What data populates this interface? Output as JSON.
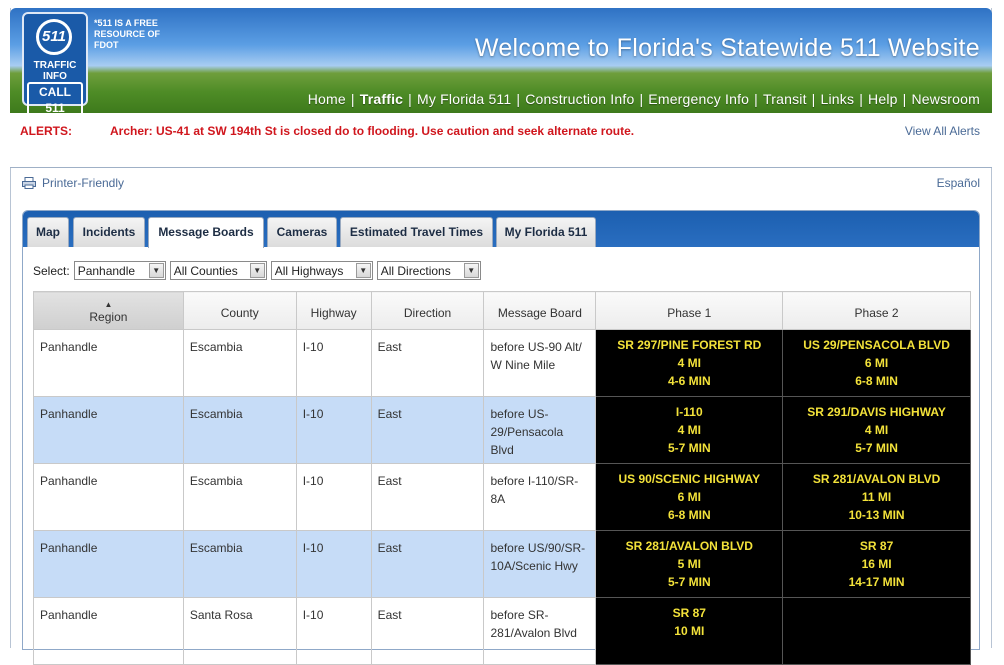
{
  "header": {
    "logo": {
      "number": "511",
      "line1": "TRAFFIC",
      "line2": "INFO",
      "call": "CALL 511"
    },
    "tagline": "*511 IS A FREE RESOURCE OF FDOT",
    "title": "Welcome to Florida's Statewide 511 Website",
    "nav": [
      "Home",
      "Traffic",
      "My Florida 511",
      "Construction Info",
      "Emergency Info",
      "Transit",
      "Links",
      "Help",
      "Newsroom"
    ],
    "active_nav": "Traffic"
  },
  "alerts": {
    "label": "ALERTS:",
    "text": "Archer: US-41 at SW 194th St is closed do to flooding. Use caution and seek alternate route.",
    "view_all": "View All Alerts"
  },
  "utility": {
    "printer": "Printer-Friendly",
    "language": "Español"
  },
  "tabs": [
    {
      "label": "Map"
    },
    {
      "label": "Incidents"
    },
    {
      "label": "Message Boards"
    },
    {
      "label": "Cameras"
    },
    {
      "label": "Estimated Travel Times"
    },
    {
      "label": "My Florida 511"
    }
  ],
  "active_tab": "Message Boards",
  "filters": {
    "label": "Select:",
    "region": "Panhandle",
    "county": "All Counties",
    "highway": "All Highways",
    "direction": "All Directions"
  },
  "table": {
    "headers": [
      "Region",
      "County",
      "Highway",
      "Direction",
      "Message Board",
      "Phase 1",
      "Phase 2"
    ],
    "rows": [
      {
        "region": "Panhandle",
        "county": "Escambia",
        "highway": "I-10",
        "direction": "East",
        "board": "before US-90 Alt/ W Nine Mile",
        "p1": [
          "SR 297/PINE FOREST RD",
          "4 MI",
          "4-6 MIN"
        ],
        "p2": [
          "US 29/PENSACOLA BLVD",
          "6 MI",
          "6-8 MIN"
        ]
      },
      {
        "region": "Panhandle",
        "county": "Escambia",
        "highway": "I-10",
        "direction": "East",
        "board": "before US-29/Pensacola Blvd",
        "p1": [
          "I-110",
          "4 MI",
          "5-7 MIN"
        ],
        "p2": [
          "SR 291/DAVIS HIGHWAY",
          "4 MI",
          "5-7 MIN"
        ]
      },
      {
        "region": "Panhandle",
        "county": "Escambia",
        "highway": "I-10",
        "direction": "East",
        "board": "before I-110/SR-8A",
        "p1": [
          "US 90/SCENIC HIGHWAY",
          "6 MI",
          "6-8 MIN"
        ],
        "p2": [
          "SR 281/AVALON BLVD",
          "11 MI",
          "10-13 MIN"
        ]
      },
      {
        "region": "Panhandle",
        "county": "Escambia",
        "highway": "I-10",
        "direction": "East",
        "board": "before US/90/SR-10A/Scenic Hwy",
        "p1": [
          "SR 281/AVALON BLVD",
          "5 MI",
          "5-7 MIN"
        ],
        "p2": [
          "SR 87",
          "16 MI",
          "14-17 MIN"
        ]
      },
      {
        "region": "Panhandle",
        "county": "Santa Rosa",
        "highway": "I-10",
        "direction": "East",
        "board": "before SR-281/Avalon Blvd",
        "p1": [
          "SR 87",
          "10 MI",
          ""
        ],
        "p2": [
          "",
          "",
          ""
        ]
      }
    ]
  }
}
